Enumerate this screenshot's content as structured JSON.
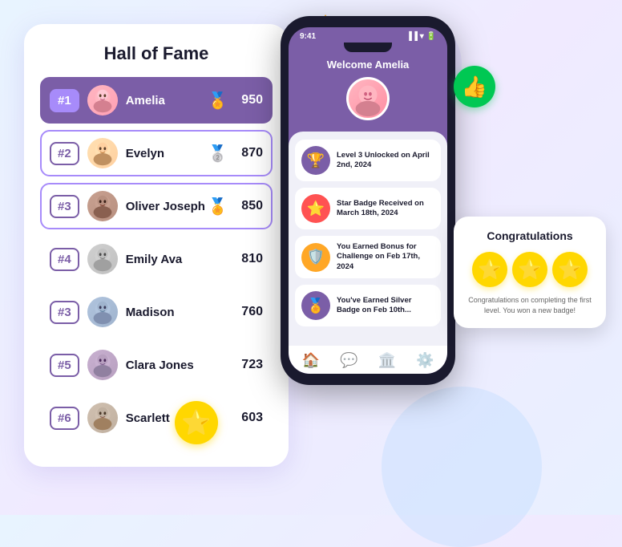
{
  "decorations": {
    "thumbsup": "👍",
    "star": "⭐"
  },
  "hallOfFame": {
    "title": "Hall of Fame",
    "rows": [
      {
        "rank": "#1",
        "name": "Amelia",
        "score": "950",
        "medal": "🏅",
        "avatarClass": "avatar-1",
        "avatarEmoji": "👩",
        "rowClass": "top1"
      },
      {
        "rank": "#2",
        "name": "Evelyn",
        "score": "870",
        "medal": "🥈",
        "avatarClass": "avatar-2",
        "avatarEmoji": "👩",
        "rowClass": "top2"
      },
      {
        "rank": "#3",
        "name": "Oliver Joseph",
        "score": "850",
        "medal": "🏅",
        "avatarClass": "avatar-3",
        "avatarEmoji": "👦",
        "rowClass": "top3"
      },
      {
        "rank": "#4",
        "name": "Emily Ava",
        "score": "810",
        "medal": "",
        "avatarClass": "avatar-4",
        "avatarEmoji": "👧",
        "rowClass": ""
      },
      {
        "rank": "#3",
        "name": "Madison",
        "score": "760",
        "medal": "",
        "avatarClass": "avatar-5",
        "avatarEmoji": "👩",
        "rowClass": ""
      },
      {
        "rank": "#5",
        "name": "Clara Jones",
        "score": "723",
        "medal": "",
        "avatarClass": "avatar-6",
        "avatarEmoji": "👩",
        "rowClass": ""
      },
      {
        "rank": "#6",
        "name": "Scarlett",
        "score": "603",
        "medal": "",
        "avatarClass": "avatar-7",
        "avatarEmoji": "👧",
        "rowClass": ""
      }
    ]
  },
  "phone": {
    "time": "9:41",
    "signal": "▐▐▐",
    "welcome": "Welcome Amelia",
    "userEmoji": "👩",
    "activities": [
      {
        "text": "Level 3 Unlocked on April 2nd, 2024",
        "iconClass": "level",
        "emoji": "🏆"
      },
      {
        "text": "Star Badge Received on March 18th, 2024",
        "iconClass": "star",
        "emoji": "⭐"
      },
      {
        "text": "You Earned Bonus for Challenge on Feb 17th, 2024",
        "iconClass": "bonus",
        "emoji": "🛡️"
      },
      {
        "text": "You've Earned Silver Badge on Feb 10th...",
        "iconClass": "silver",
        "emoji": "🏅"
      }
    ]
  },
  "congrats": {
    "title": "Congratulations",
    "stars": [
      "⭐",
      "⭐",
      "⭐"
    ],
    "text": "Congratulations on completing the first level. You won a new badge!"
  }
}
